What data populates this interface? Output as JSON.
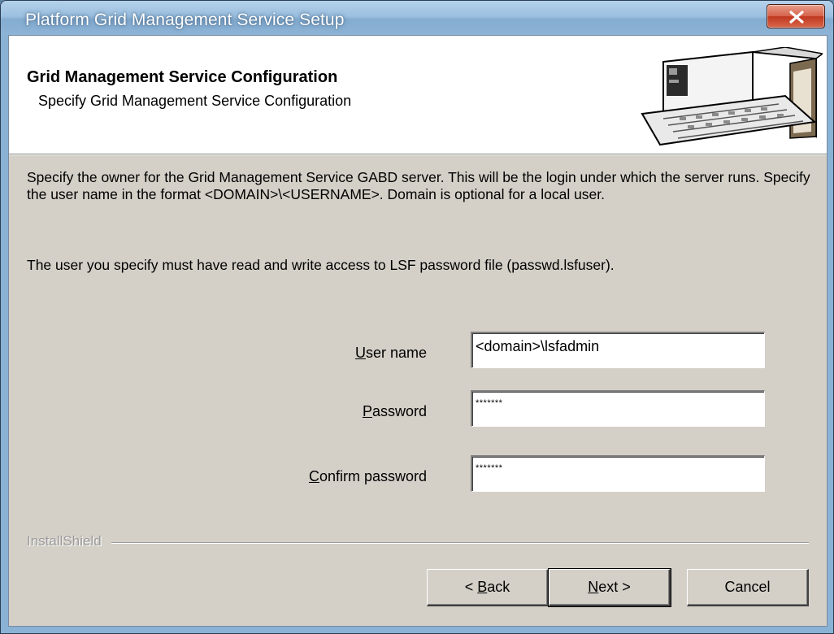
{
  "window": {
    "title": "Platform Grid Management Service Setup",
    "close_label": "X"
  },
  "header": {
    "title": "Grid Management Service Configuration",
    "subtitle": "Specify Grid Management Service Configuration"
  },
  "description": {
    "paragraph1": "Specify the owner for the Grid Management Service GABD server.  This will be the login under which the server runs. Specify the user name in the format <DOMAIN>\\<USERNAME>. Domain is optional for a local user.",
    "paragraph2": "The user you specify must have read and write access to LSF password file (passwd.lsfuser)."
  },
  "form": {
    "username_label_hotkey": "U",
    "username_label_rest": "ser name",
    "username_value": "<domain>\\lsfadmin",
    "password_label_hotkey": "P",
    "password_label_rest": "assword",
    "password_value": "*******",
    "confirm_label_hotkey": "C",
    "confirm_label_rest": "onfirm password",
    "confirm_value": "*******"
  },
  "footer": {
    "brand": "InstallShield",
    "back_prefix": "< ",
    "back_hotkey": "B",
    "back_rest": "ack",
    "next_hotkey": "N",
    "next_rest": "ext >",
    "cancel_label": "Cancel"
  },
  "colors": {
    "dialog_face": "#d4d0c8",
    "titlebar": "#9cc0e0",
    "close_button": "#c0381f"
  },
  "icons": {
    "close": "close-icon",
    "header_graphic": "computer-keyboard-icon"
  }
}
